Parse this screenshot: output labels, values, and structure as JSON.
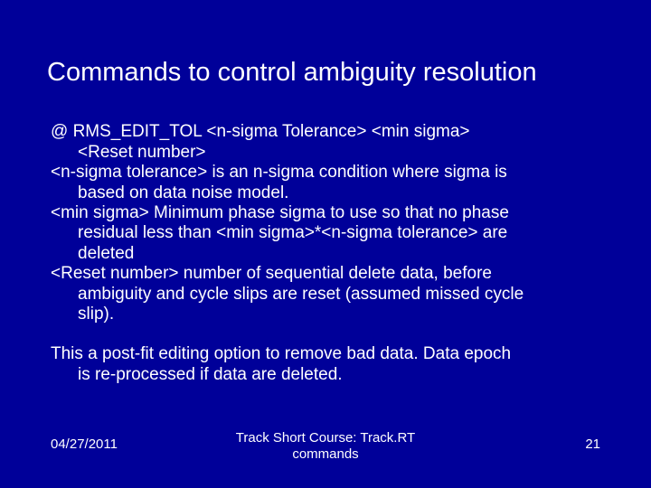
{
  "title": "Commands to control ambiguity resolution",
  "body": {
    "l1": "@ RMS_EDIT_TOL <n-sigma Tolerance> <min sigma>",
    "l2": "<Reset number>",
    "l3": "<n-sigma tolerance> is an n-sigma condition where sigma is",
    "l4": "based on data noise model.",
    "l5": "<min sigma> Minimum phase sigma to use so that no phase",
    "l6": "residual less than  <min sigma>*<n-sigma tolerance> are",
    "l7": "deleted",
    "l8": "<Reset number> number of sequential delete data, before",
    "l9": "ambiguity and cycle slips are reset (assumed missed cycle",
    "l10": "slip).",
    "p2a": "This a post-fit editing option to remove bad data.  Data epoch",
    "p2b": "is re-processed if data are deleted."
  },
  "footer": {
    "date": "04/27/2011",
    "center1": "Track Short Course: Track.RT",
    "center2": "commands",
    "page": "21"
  }
}
